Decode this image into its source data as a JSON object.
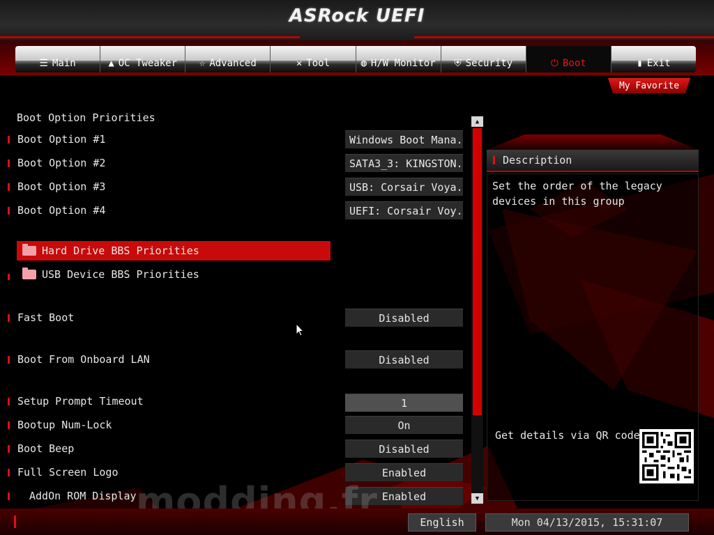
{
  "header": {
    "logo_text": "ASRock UEFI"
  },
  "nav": {
    "tabs": [
      {
        "label": "Main",
        "icon": "list-icon"
      },
      {
        "label": "OC Tweaker",
        "icon": "rocket-icon"
      },
      {
        "label": "Advanced",
        "icon": "star-icon"
      },
      {
        "label": "Tool",
        "icon": "tools-icon"
      },
      {
        "label": "H/W Monitor",
        "icon": "gauge-icon"
      },
      {
        "label": "Security",
        "icon": "shield-icon"
      },
      {
        "label": "Boot",
        "icon": "power-icon",
        "active": true
      },
      {
        "label": "Exit",
        "icon": "exit-door-icon"
      }
    ],
    "favorite_label": "My Favorite"
  },
  "boot": {
    "section_title": "Boot Option Priorities",
    "options": [
      {
        "label": "Boot Option #1",
        "value": "Windows Boot Mana..."
      },
      {
        "label": "Boot Option #2",
        "value": "SATA3_3: KINGSTON..."
      },
      {
        "label": "Boot Option #3",
        "value": "USB: Corsair Voya..."
      },
      {
        "label": "Boot Option #4",
        "value": "UEFI: Corsair Voy..."
      }
    ],
    "submenus": [
      {
        "label": "Hard Drive BBS Priorities",
        "selected": true
      },
      {
        "label": "USB Device BBS Priorities",
        "selected": false
      }
    ],
    "fast_boot": {
      "label": "Fast Boot",
      "value": "Disabled"
    },
    "onboard_lan": {
      "label": "Boot From Onboard LAN",
      "value": "Disabled"
    },
    "setup_prompt": {
      "label": "Setup Prompt Timeout",
      "value": "1"
    },
    "numlock": {
      "label": "Bootup Num-Lock",
      "value": "On"
    },
    "beep": {
      "label": "Boot Beep",
      "value": "Disabled"
    },
    "logo": {
      "label": "Full Screen Logo",
      "value": "Enabled"
    },
    "addon_rom": {
      "label": "AddOn ROM Display",
      "value": "Enabled"
    }
  },
  "description": {
    "title": "Description",
    "text": "Set the order of the legacy devices in this group",
    "qr_label": "Get details via QR code"
  },
  "footer": {
    "language": "English",
    "datetime": "Mon 04/13/2015, 15:31:07",
    "watermark": "modding.fr"
  },
  "colors": {
    "accent": "#d40000",
    "selected_row": "#c80a0a",
    "value_box": "#2a2a2a"
  }
}
